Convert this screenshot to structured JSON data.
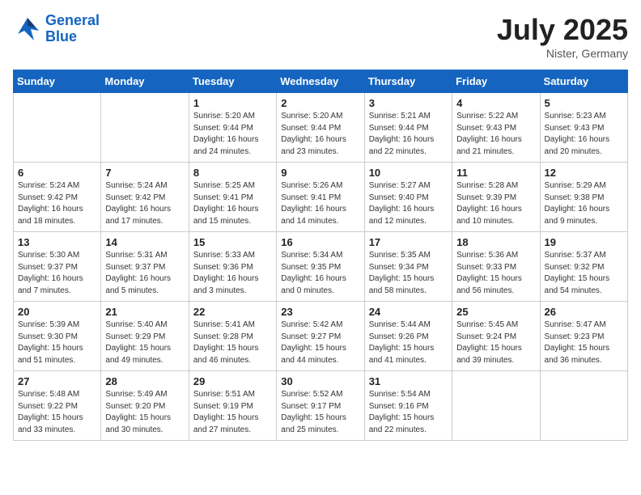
{
  "header": {
    "logo_line1": "General",
    "logo_line2": "Blue",
    "month_year": "July 2025",
    "location": "Nister, Germany"
  },
  "weekdays": [
    "Sunday",
    "Monday",
    "Tuesday",
    "Wednesday",
    "Thursday",
    "Friday",
    "Saturday"
  ],
  "weeks": [
    [
      {
        "day": "",
        "detail": ""
      },
      {
        "day": "",
        "detail": ""
      },
      {
        "day": "1",
        "detail": "Sunrise: 5:20 AM\nSunset: 9:44 PM\nDaylight: 16 hours and 24 minutes."
      },
      {
        "day": "2",
        "detail": "Sunrise: 5:20 AM\nSunset: 9:44 PM\nDaylight: 16 hours and 23 minutes."
      },
      {
        "day": "3",
        "detail": "Sunrise: 5:21 AM\nSunset: 9:44 PM\nDaylight: 16 hours and 22 minutes."
      },
      {
        "day": "4",
        "detail": "Sunrise: 5:22 AM\nSunset: 9:43 PM\nDaylight: 16 hours and 21 minutes."
      },
      {
        "day": "5",
        "detail": "Sunrise: 5:23 AM\nSunset: 9:43 PM\nDaylight: 16 hours and 20 minutes."
      }
    ],
    [
      {
        "day": "6",
        "detail": "Sunrise: 5:24 AM\nSunset: 9:42 PM\nDaylight: 16 hours and 18 minutes."
      },
      {
        "day": "7",
        "detail": "Sunrise: 5:24 AM\nSunset: 9:42 PM\nDaylight: 16 hours and 17 minutes."
      },
      {
        "day": "8",
        "detail": "Sunrise: 5:25 AM\nSunset: 9:41 PM\nDaylight: 16 hours and 15 minutes."
      },
      {
        "day": "9",
        "detail": "Sunrise: 5:26 AM\nSunset: 9:41 PM\nDaylight: 16 hours and 14 minutes."
      },
      {
        "day": "10",
        "detail": "Sunrise: 5:27 AM\nSunset: 9:40 PM\nDaylight: 16 hours and 12 minutes."
      },
      {
        "day": "11",
        "detail": "Sunrise: 5:28 AM\nSunset: 9:39 PM\nDaylight: 16 hours and 10 minutes."
      },
      {
        "day": "12",
        "detail": "Sunrise: 5:29 AM\nSunset: 9:38 PM\nDaylight: 16 hours and 9 minutes."
      }
    ],
    [
      {
        "day": "13",
        "detail": "Sunrise: 5:30 AM\nSunset: 9:37 PM\nDaylight: 16 hours and 7 minutes."
      },
      {
        "day": "14",
        "detail": "Sunrise: 5:31 AM\nSunset: 9:37 PM\nDaylight: 16 hours and 5 minutes."
      },
      {
        "day": "15",
        "detail": "Sunrise: 5:33 AM\nSunset: 9:36 PM\nDaylight: 16 hours and 3 minutes."
      },
      {
        "day": "16",
        "detail": "Sunrise: 5:34 AM\nSunset: 9:35 PM\nDaylight: 16 hours and 0 minutes."
      },
      {
        "day": "17",
        "detail": "Sunrise: 5:35 AM\nSunset: 9:34 PM\nDaylight: 15 hours and 58 minutes."
      },
      {
        "day": "18",
        "detail": "Sunrise: 5:36 AM\nSunset: 9:33 PM\nDaylight: 15 hours and 56 minutes."
      },
      {
        "day": "19",
        "detail": "Sunrise: 5:37 AM\nSunset: 9:32 PM\nDaylight: 15 hours and 54 minutes."
      }
    ],
    [
      {
        "day": "20",
        "detail": "Sunrise: 5:39 AM\nSunset: 9:30 PM\nDaylight: 15 hours and 51 minutes."
      },
      {
        "day": "21",
        "detail": "Sunrise: 5:40 AM\nSunset: 9:29 PM\nDaylight: 15 hours and 49 minutes."
      },
      {
        "day": "22",
        "detail": "Sunrise: 5:41 AM\nSunset: 9:28 PM\nDaylight: 15 hours and 46 minutes."
      },
      {
        "day": "23",
        "detail": "Sunrise: 5:42 AM\nSunset: 9:27 PM\nDaylight: 15 hours and 44 minutes."
      },
      {
        "day": "24",
        "detail": "Sunrise: 5:44 AM\nSunset: 9:26 PM\nDaylight: 15 hours and 41 minutes."
      },
      {
        "day": "25",
        "detail": "Sunrise: 5:45 AM\nSunset: 9:24 PM\nDaylight: 15 hours and 39 minutes."
      },
      {
        "day": "26",
        "detail": "Sunrise: 5:47 AM\nSunset: 9:23 PM\nDaylight: 15 hours and 36 minutes."
      }
    ],
    [
      {
        "day": "27",
        "detail": "Sunrise: 5:48 AM\nSunset: 9:22 PM\nDaylight: 15 hours and 33 minutes."
      },
      {
        "day": "28",
        "detail": "Sunrise: 5:49 AM\nSunset: 9:20 PM\nDaylight: 15 hours and 30 minutes."
      },
      {
        "day": "29",
        "detail": "Sunrise: 5:51 AM\nSunset: 9:19 PM\nDaylight: 15 hours and 27 minutes."
      },
      {
        "day": "30",
        "detail": "Sunrise: 5:52 AM\nSunset: 9:17 PM\nDaylight: 15 hours and 25 minutes."
      },
      {
        "day": "31",
        "detail": "Sunrise: 5:54 AM\nSunset: 9:16 PM\nDaylight: 15 hours and 22 minutes."
      },
      {
        "day": "",
        "detail": ""
      },
      {
        "day": "",
        "detail": ""
      }
    ]
  ]
}
